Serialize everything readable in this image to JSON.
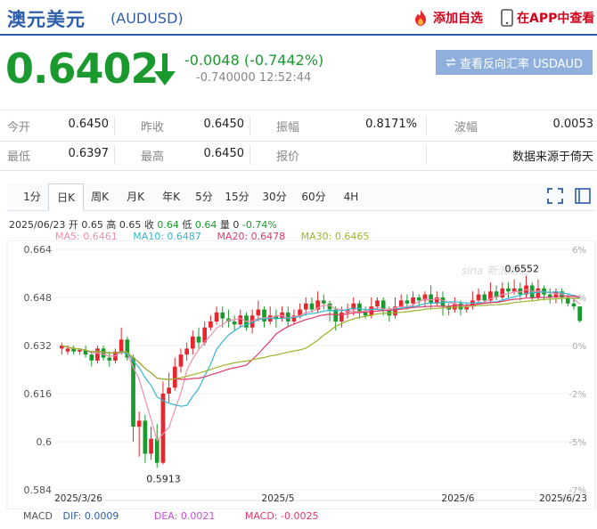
{
  "header": {
    "title_zh": "澳元美元",
    "code": "(AUDUSD)",
    "add_watchlist": "添加自选",
    "open_app": "在APP中查看"
  },
  "quote": {
    "price": "0.6402",
    "change": "-0.0048 (-0.7442%)",
    "sub_line": "-0.740000 12:52:44",
    "reverse_btn": "查看反向汇率 USDAUD"
  },
  "stats": {
    "row1": [
      {
        "label": "今开",
        "value": "0.6450"
      },
      {
        "label": "昨收",
        "value": "0.6450"
      },
      {
        "label": "振幅",
        "value": "0.8171%"
      },
      {
        "label": "波幅",
        "value": "0.0053"
      }
    ],
    "row2": [
      {
        "label": "最低",
        "value": "0.6397"
      },
      {
        "label": "最高",
        "value": "0.6450"
      },
      {
        "label": "报价",
        "value": "数据来源于倚天"
      }
    ]
  },
  "tabs": [
    "1分",
    "日K",
    "周K",
    "月K",
    "年K",
    "5分",
    "15分",
    "30分",
    "60分",
    "4H"
  ],
  "active_tab": 1,
  "chart_info": {
    "date": "2025/06/23",
    "open_lbl": "开",
    "open": "0.65",
    "high_lbl": "高",
    "high": "0.65",
    "close_lbl": "收",
    "close": "0.64",
    "low_lbl": "低",
    "low": "0.64",
    "vol_lbl": "量",
    "vol": "0",
    "pct": "-0.74%"
  },
  "ma": {
    "ma5": "MA5: 0.6461",
    "ma10": "MA10: 0.6487",
    "ma20": "MA20: 0.6478",
    "ma30": "MA30: 0.6465"
  },
  "macd": {
    "label": "MACD",
    "dif": "DIF: 0.0009",
    "dea": "DEA: 0.0021",
    "macd": "MACD: -0.0025"
  },
  "colors": {
    "up": "#e8262d",
    "down": "#1a9a2e",
    "ma5": "#f28fb0",
    "ma10": "#35b7d1",
    "ma20": "#e03a6b",
    "ma30": "#9cb52a",
    "accent": "#2d5ea9"
  },
  "chart_data": {
    "type": "candlestick",
    "y_left_ticks": [
      "0.664",
      "0.648",
      "0.632",
      "0.616",
      "0.6",
      "0.584"
    ],
    "y_right_ticks": [
      "6%",
      "2%",
      "0%",
      "-2%",
      "-5%",
      "-7%"
    ],
    "x_ticks": [
      "2025/3/26",
      "2025/5",
      "2025/6",
      "2025/6/23"
    ],
    "ylim": [
      0.584,
      0.664
    ],
    "max_label": "0.6552",
    "min_label": "0.5913",
    "watermark": "sina 新浪财经",
    "candles": [
      [
        0.631,
        0.632,
        0.629,
        0.633
      ],
      [
        0.63,
        0.631,
        0.629,
        0.632
      ],
      [
        0.631,
        0.63,
        0.629,
        0.632
      ],
      [
        0.63,
        0.6305,
        0.629,
        0.631
      ],
      [
        0.6305,
        0.629,
        0.628,
        0.632
      ],
      [
        0.629,
        0.627,
        0.625,
        0.63
      ],
      [
        0.627,
        0.631,
        0.626,
        0.632
      ],
      [
        0.631,
        0.628,
        0.627,
        0.632
      ],
      [
        0.628,
        0.627,
        0.625,
        0.63
      ],
      [
        0.627,
        0.63,
        0.626,
        0.631
      ],
      [
        0.63,
        0.634,
        0.629,
        0.638
      ],
      [
        0.634,
        0.628,
        0.627,
        0.635
      ],
      [
        0.628,
        0.605,
        0.6,
        0.629
      ],
      [
        0.605,
        0.607,
        0.595,
        0.61
      ],
      [
        0.607,
        0.596,
        0.593,
        0.609
      ],
      [
        0.596,
        0.601,
        0.594,
        0.605
      ],
      [
        0.601,
        0.593,
        0.5913,
        0.606
      ],
      [
        0.593,
        0.616,
        0.5925,
        0.62
      ],
      [
        0.616,
        0.618,
        0.613,
        0.623
      ],
      [
        0.618,
        0.625,
        0.617,
        0.628
      ],
      [
        0.625,
        0.629,
        0.623,
        0.631
      ],
      [
        0.629,
        0.631,
        0.627,
        0.633
      ],
      [
        0.631,
        0.635,
        0.629,
        0.637
      ],
      [
        0.635,
        0.633,
        0.631,
        0.638
      ],
      [
        0.633,
        0.638,
        0.632,
        0.64
      ],
      [
        0.638,
        0.64,
        0.637,
        0.642
      ],
      [
        0.64,
        0.643,
        0.639,
        0.645
      ],
      [
        0.643,
        0.641,
        0.638,
        0.645
      ],
      [
        0.641,
        0.64,
        0.638,
        0.644
      ],
      [
        0.64,
        0.639,
        0.637,
        0.642
      ],
      [
        0.639,
        0.642,
        0.638,
        0.644
      ],
      [
        0.642,
        0.638,
        0.637,
        0.643
      ],
      [
        0.638,
        0.642,
        0.636,
        0.644
      ],
      [
        0.642,
        0.644,
        0.64,
        0.647
      ],
      [
        0.644,
        0.64,
        0.638,
        0.645
      ],
      [
        0.64,
        0.642,
        0.639,
        0.645
      ],
      [
        0.642,
        0.641,
        0.638,
        0.644
      ],
      [
        0.641,
        0.643,
        0.64,
        0.645
      ],
      [
        0.643,
        0.64,
        0.638,
        0.645
      ],
      [
        0.64,
        0.642,
        0.639,
        0.644
      ],
      [
        0.642,
        0.644,
        0.641,
        0.646
      ],
      [
        0.644,
        0.646,
        0.642,
        0.648
      ],
      [
        0.646,
        0.644,
        0.643,
        0.648
      ],
      [
        0.644,
        0.647,
        0.643,
        0.65
      ],
      [
        0.647,
        0.646,
        0.644,
        0.649
      ],
      [
        0.646,
        0.644,
        0.64,
        0.647
      ],
      [
        0.644,
        0.64,
        0.637,
        0.645
      ],
      [
        0.64,
        0.643,
        0.638,
        0.645
      ],
      [
        0.643,
        0.644,
        0.641,
        0.646
      ],
      [
        0.644,
        0.646,
        0.642,
        0.648
      ],
      [
        0.646,
        0.643,
        0.641,
        0.647
      ],
      [
        0.643,
        0.642,
        0.641,
        0.645
      ],
      [
        0.642,
        0.645,
        0.641,
        0.648
      ],
      [
        0.645,
        0.647,
        0.644,
        0.648
      ],
      [
        0.647,
        0.644,
        0.642,
        0.648
      ],
      [
        0.644,
        0.642,
        0.64,
        0.645
      ],
      [
        0.642,
        0.645,
        0.641,
        0.648
      ],
      [
        0.645,
        0.647,
        0.644,
        0.649
      ],
      [
        0.647,
        0.646,
        0.644,
        0.649
      ],
      [
        0.646,
        0.648,
        0.645,
        0.65
      ],
      [
        0.648,
        0.647,
        0.645,
        0.649
      ],
      [
        0.647,
        0.649,
        0.645,
        0.65
      ],
      [
        0.649,
        0.646,
        0.644,
        0.652
      ],
      [
        0.646,
        0.648,
        0.645,
        0.65
      ],
      [
        0.648,
        0.645,
        0.642,
        0.65
      ],
      [
        0.645,
        0.644,
        0.642,
        0.646
      ],
      [
        0.644,
        0.646,
        0.643,
        0.648
      ],
      [
        0.646,
        0.644,
        0.642,
        0.647
      ],
      [
        0.644,
        0.645,
        0.643,
        0.646
      ],
      [
        0.645,
        0.647,
        0.644,
        0.65
      ],
      [
        0.647,
        0.649,
        0.646,
        0.651
      ],
      [
        0.649,
        0.647,
        0.646,
        0.65
      ],
      [
        0.647,
        0.65,
        0.646,
        0.653
      ],
      [
        0.65,
        0.648,
        0.647,
        0.652
      ],
      [
        0.648,
        0.651,
        0.647,
        0.653
      ],
      [
        0.651,
        0.65,
        0.648,
        0.653
      ],
      [
        0.65,
        0.651,
        0.649,
        0.654
      ],
      [
        0.651,
        0.649,
        0.647,
        0.653
      ],
      [
        0.649,
        0.652,
        0.648,
        0.6552
      ],
      [
        0.652,
        0.648,
        0.647,
        0.653
      ],
      [
        0.648,
        0.651,
        0.647,
        0.654
      ],
      [
        0.651,
        0.649,
        0.647,
        0.652
      ],
      [
        0.649,
        0.648,
        0.646,
        0.651
      ],
      [
        0.648,
        0.65,
        0.646,
        0.651
      ],
      [
        0.65,
        0.648,
        0.646,
        0.651
      ],
      [
        0.648,
        0.646,
        0.645,
        0.649
      ],
      [
        0.646,
        0.645,
        0.644,
        0.648
      ],
      [
        0.645,
        0.6402,
        0.6397,
        0.645
      ]
    ]
  }
}
